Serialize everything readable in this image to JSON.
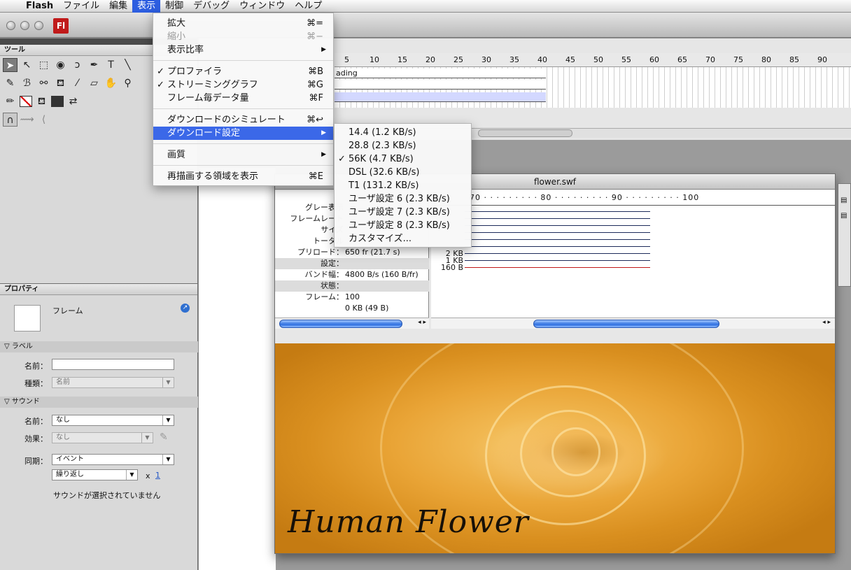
{
  "menubar": {
    "apple": "",
    "items": [
      "Flash",
      "ファイル",
      "編集",
      "表示",
      "制御",
      "デバッグ",
      "ウィンドウ",
      "ヘルプ"
    ],
    "active_index": 3
  },
  "app_icon": "Fl",
  "tools_panel": {
    "title": "ツール"
  },
  "properties_panel": {
    "title": "プロパティ",
    "type_label": "フレーム",
    "label_section": "ラベル",
    "name_label": "名前：",
    "name_value": "",
    "kind_label": "種類：",
    "kind_value": "名前",
    "sound_section": "サウンド",
    "sound_name_label": "名前：",
    "sound_name_value": "なし",
    "effect_label": "効果：",
    "effect_value": "なし",
    "sync_label": "同期：",
    "sync_value": "イベント",
    "repeat_value": "繰り返し",
    "repeat_x": "x",
    "repeat_count": "1",
    "status": "サウンドが選択されていません"
  },
  "timeline": {
    "ticks": [
      "5",
      "10",
      "15",
      "20",
      "25",
      "30",
      "35",
      "40",
      "45",
      "50",
      "55",
      "60",
      "65",
      "70",
      "75",
      "80",
      "85",
      "90"
    ],
    "layer_label": "ading"
  },
  "swf_window": {
    "title": "flower.swf",
    "rows": [
      {
        "k": "グレー表示",
        "v": ""
      },
      {
        "k": "フレームレート",
        "v": ""
      },
      {
        "k": "サイズ",
        "v": ""
      },
      {
        "k": "トータル",
        "v": ""
      },
      {
        "k": "プリロード：",
        "v": "650 fr (21.7 s)"
      },
      {
        "k": "設定：",
        "v": "",
        "grey": true
      },
      {
        "k": "バンド幅：",
        "v": "4800 B/s (160 B/fr)"
      },
      {
        "k": "状態：",
        "v": "",
        "grey": true
      },
      {
        "k": "フレーム：",
        "v": "100"
      },
      {
        "k": "",
        "v": "0 KB (49 B)"
      }
    ],
    "graph_ruler": "70 · · · · · · · · · 80 · · · · · · · · · 90 · · · · · · · · · 100",
    "graph_labels": [
      "2 KB",
      "1 KB",
      "160 B"
    ],
    "photo_caption": "Human Flower"
  },
  "view_menu": {
    "items": [
      {
        "label": "拡大",
        "shortcut": "⌘=",
        "check": false,
        "disabled": false,
        "submenu": false
      },
      {
        "label": "縮小",
        "shortcut": "⌘−",
        "check": false,
        "disabled": true,
        "submenu": false
      },
      {
        "label": "表示比率",
        "shortcut": "",
        "check": false,
        "disabled": false,
        "submenu": true
      },
      {
        "label": "プロファイラ",
        "shortcut": "⌘B",
        "check": true,
        "disabled": false,
        "submenu": false
      },
      {
        "label": "ストリーミンググラフ",
        "shortcut": "⌘G",
        "check": true,
        "disabled": false,
        "submenu": false
      },
      {
        "label": "フレーム毎データ量",
        "shortcut": "⌘F",
        "check": false,
        "disabled": false,
        "submenu": false
      },
      {
        "label": "ダウンロードのシミュレート",
        "shortcut": "⌘↩",
        "check": false,
        "disabled": false,
        "submenu": false
      },
      {
        "label": "ダウンロード設定",
        "shortcut": "",
        "check": false,
        "disabled": false,
        "submenu": true,
        "highlighted": true
      },
      {
        "label": "画質",
        "shortcut": "",
        "check": false,
        "disabled": false,
        "submenu": true
      },
      {
        "label": "再描画する領域を表示",
        "shortcut": "⌘E",
        "check": false,
        "disabled": false,
        "submenu": false
      }
    ],
    "check_glyph": "✓",
    "submenu_glyph": "▶"
  },
  "download_menu": {
    "items": [
      {
        "label": "14.4 (1.2 KB/s)",
        "check": false
      },
      {
        "label": "28.8 (2.3 KB/s)",
        "check": false
      },
      {
        "label": "56K (4.7 KB/s)",
        "check": true
      },
      {
        "label": "DSL (32.6 KB/s)",
        "check": false
      },
      {
        "label": "T1 (131.2 KB/s)",
        "check": false
      },
      {
        "label": "ユーザ設定 6 (2.3 KB/s)",
        "check": false
      },
      {
        "label": "ユーザ設定 7 (2.3 KB/s)",
        "check": false
      },
      {
        "label": "ユーザ設定 8 (2.3 KB/s)",
        "check": false
      },
      {
        "label": "カスタマイズ...",
        "check": false
      }
    ]
  },
  "colors": {
    "highlight": "#3b68e8",
    "menubar_active": "#2d5ee0"
  }
}
